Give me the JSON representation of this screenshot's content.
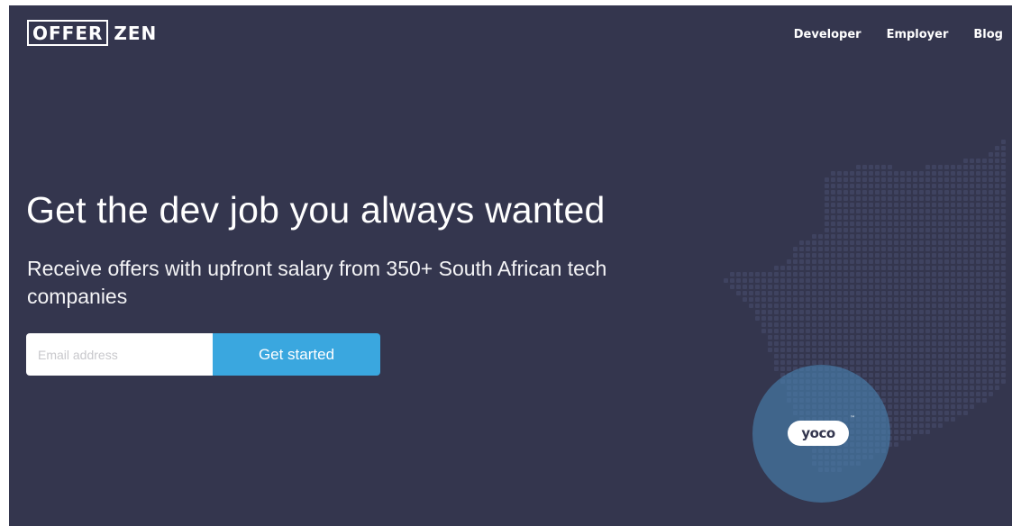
{
  "header": {
    "logo_boxed": "OFFER",
    "logo_plain": "ZEN",
    "nav": {
      "developer": "Developer",
      "employer": "Employer",
      "blog": "Blog"
    }
  },
  "hero": {
    "headline": "Get the dev job you always wanted",
    "subline": "Receive offers with upfront salary from 350+ South African tech companies",
    "email_placeholder": "Email address",
    "cta_label": "Get started"
  },
  "partner": {
    "name": "YOCO",
    "mark": "™"
  },
  "colors": {
    "background": "#34364e",
    "accent": "#3aa7df",
    "partner_circle": "#4882b2"
  },
  "icons": {
    "map": "south-africa-dot-map"
  }
}
